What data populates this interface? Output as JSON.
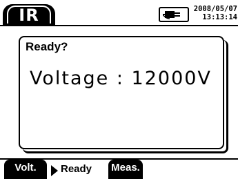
{
  "header": {
    "mode_label": "IR",
    "date": "2008/05/07",
    "time": "13:13:14",
    "power_icon": "ac-plug-icon"
  },
  "dialog": {
    "title": "Ready?",
    "message": "Voltage : 12000V"
  },
  "footer": {
    "step_volt": "Volt.",
    "step_ready": "Ready",
    "step_meas": "Meas.",
    "arrow_icon": "triangle-right-icon"
  }
}
